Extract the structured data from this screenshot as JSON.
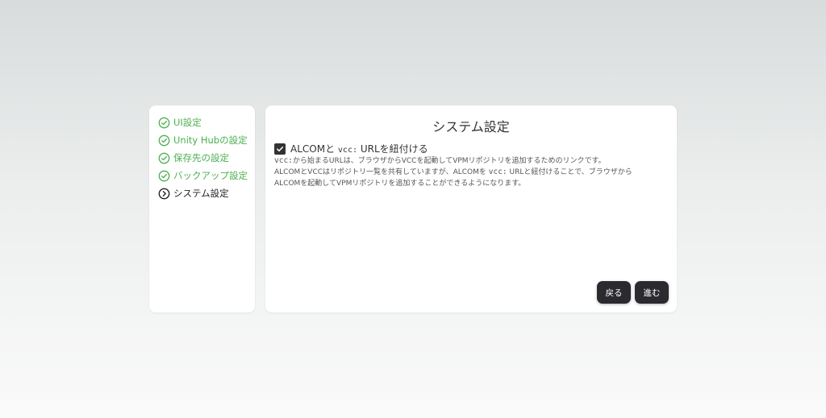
{
  "sidebar": {
    "steps": [
      {
        "label": "UI設定",
        "state": "done",
        "icon": "check-circle-icon"
      },
      {
        "label": "Unity Hubの設定",
        "state": "done",
        "icon": "check-circle-icon"
      },
      {
        "label": "保存先の設定",
        "state": "done",
        "icon": "check-circle-icon"
      },
      {
        "label": "バックアップ設定",
        "state": "done",
        "icon": "check-circle-icon"
      },
      {
        "label": "システム設定",
        "state": "current",
        "icon": "chevron-right-circle-icon"
      }
    ]
  },
  "main": {
    "title": "システム設定",
    "option": {
      "checked": true,
      "label_pre": "ALCOMと",
      "label_code": "vcc:",
      "label_post": "URLを紐付ける"
    },
    "description": {
      "line1_code": "vcc:",
      "line1_text": "から始まるURLは、ブラウザからVCCを起動してVPMリポジトリを追加するためのリンクです。",
      "line2_pre": "ALCOMとVCCはリポジトリ一覧を共有していますが、ALCOMを",
      "line2_code": "vcc:",
      "line2_post": "URLと紐付けることで、ブラウザから",
      "line3": "ALCOMを起動してVPMリポジトリを追加することができるようになります。"
    },
    "buttons": {
      "back": "戻る",
      "next": "進む"
    }
  },
  "colors": {
    "done": "#4caf50",
    "current": "#222222",
    "button_bg": "#2b2b2f"
  }
}
